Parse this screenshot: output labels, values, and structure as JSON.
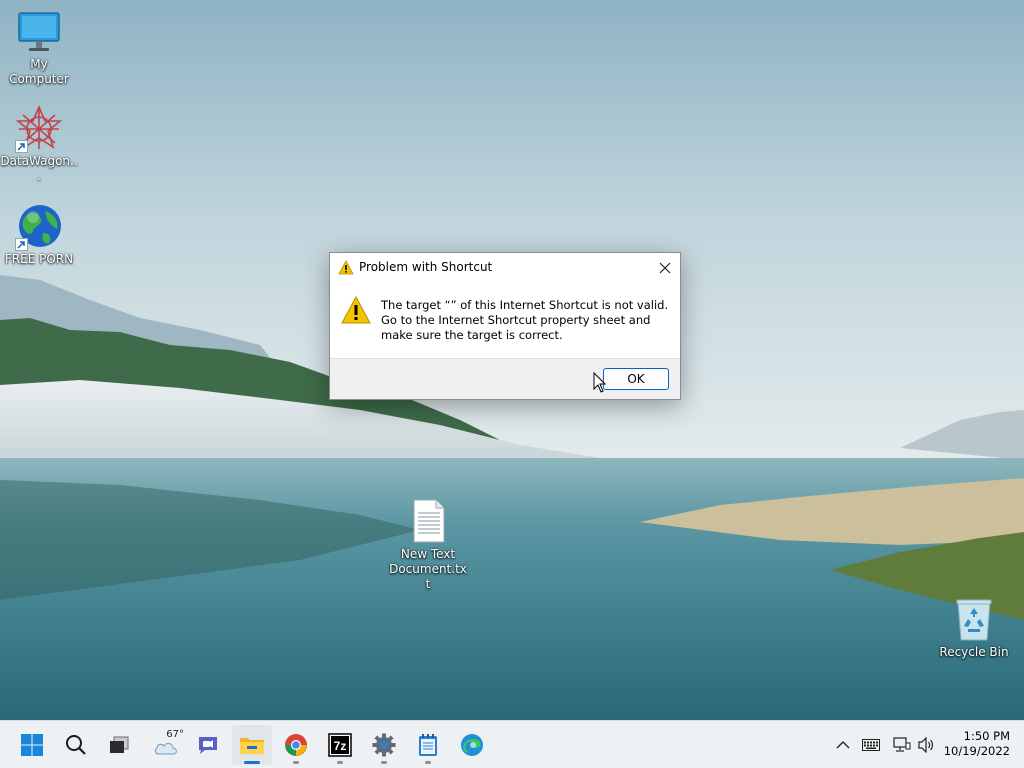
{
  "desktop": {
    "icons": [
      {
        "label": "My Computer",
        "icon": "monitor-icon"
      },
      {
        "label": "DataWagon...",
        "icon": "datawagon-icon"
      },
      {
        "label": "FREE PORN",
        "icon": "globe-icon"
      },
      {
        "label": "New Text Document.txt",
        "icon": "text-document-icon"
      },
      {
        "label": "Recycle Bin",
        "icon": "recycle-bin-icon"
      }
    ]
  },
  "dialog": {
    "title": "Problem with Shortcut",
    "message": "The target “” of this Internet Shortcut is not valid. Go to the Internet Shortcut property sheet and make sure the target is correct.",
    "ok_label": "OK",
    "icon": "warning-icon"
  },
  "taskbar": {
    "items": [
      {
        "name": "start",
        "icon": "windows-start-icon"
      },
      {
        "name": "search",
        "icon": "search-icon"
      },
      {
        "name": "task-view",
        "icon": "task-view-icon"
      },
      {
        "name": "widgets",
        "icon": "weather-cloud-icon"
      },
      {
        "name": "chat",
        "icon": "teams-chat-icon"
      },
      {
        "name": "file-explorer",
        "icon": "folder-icon",
        "active": true
      },
      {
        "name": "chrome",
        "icon": "chrome-icon"
      },
      {
        "name": "7zip",
        "icon": "7zip-icon"
      },
      {
        "name": "settings",
        "icon": "gear-icon"
      },
      {
        "name": "notepad",
        "icon": "notepad-icon"
      },
      {
        "name": "edge",
        "icon": "edge-icon"
      }
    ],
    "weather_temp": "67°",
    "tray": [
      "chevron-up-icon",
      "keyboard-icon",
      "network-icon",
      "volume-icon"
    ],
    "time": "1:50 PM",
    "date": "10/19/2022"
  },
  "colors": {
    "accent": "#0067c0",
    "warning": "#f5c400"
  }
}
